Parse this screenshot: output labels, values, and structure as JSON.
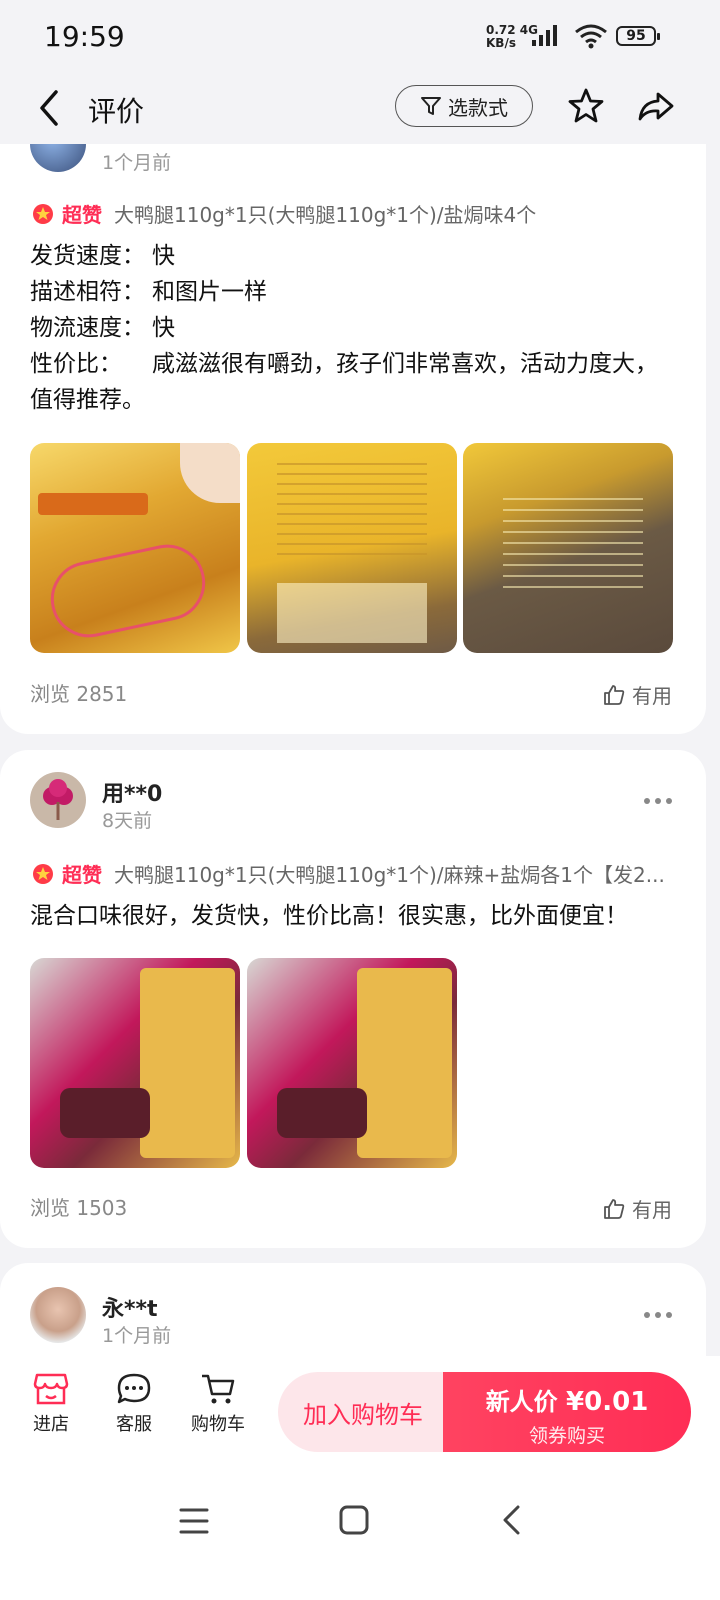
{
  "status_bar": {
    "time": "19:59",
    "speed_value": "0.72",
    "speed_unit": "KB/s",
    "network": "4G",
    "battery": "95"
  },
  "header": {
    "title": "评价",
    "filter_label": "选款式"
  },
  "reviews": [
    {
      "time": "1个月前",
      "tag": "超赞",
      "spec": "大鸭腿110g*1只(大鸭腿110g*1个)/盐焗味4个",
      "fields": [
        {
          "k": "发货速度：",
          "v": "快"
        },
        {
          "k": "描述相符：",
          "v": "和图片一样"
        },
        {
          "k": "物流速度：",
          "v": "快"
        },
        {
          "k": "性价比：",
          "v": "咸滋滋很有嚼劲，孩子们非常喜欢，活动力度大，值得推荐。"
        }
      ],
      "views": "浏览 2851",
      "useful": "有用"
    },
    {
      "user": "用**0",
      "time": "8天前",
      "tag": "超赞",
      "spec": "大鸭腿110g*1只(大鸭腿110g*1个)/麻辣+盐焗各1个【发2...",
      "text": "混合口味很好，发货快，性价比高！很实惠，比外面便宜！",
      "views": "浏览 1503",
      "useful": "有用"
    },
    {
      "user": "永**t",
      "time": "1个月前"
    }
  ],
  "bottom_bar": {
    "shop": "进店",
    "service": "客服",
    "cart": "购物车",
    "add_cart": "加入购物车",
    "buy_label": "新人价",
    "buy_price": "¥0.01",
    "buy_sub": "领券购买"
  },
  "colors": {
    "accent": "#ff2d55",
    "background": "#f3f3f6"
  }
}
